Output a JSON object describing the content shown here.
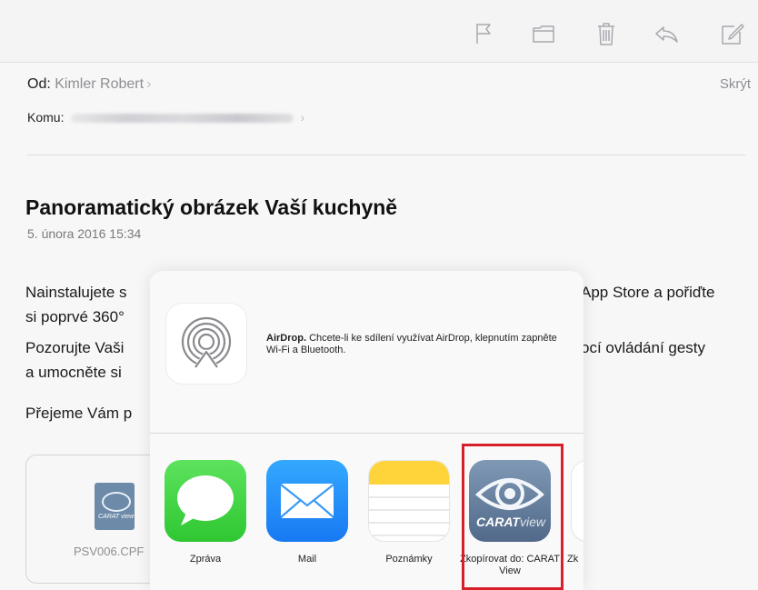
{
  "toolbar": {
    "icons": [
      "flag-icon",
      "folder-icon",
      "trash-icon",
      "reply-icon",
      "compose-icon"
    ]
  },
  "header": {
    "from_label": "Od:",
    "from_name": "Kimler Robert",
    "to_label": "Komu:",
    "hide_link": "Skrýt",
    "chevron": "›"
  },
  "message": {
    "subject": "Panoramatický obrázek Vaší kuchyně",
    "date": "5. února 2016 15:34",
    "para1_left_line1": "Nainstalujete s",
    "para1_left_line2": "si poprvé 360°",
    "para1_right_line1": "App Store a pořiďte",
    "para2_left_line1": "Pozorujte Vaši",
    "para2_left_line2": "a umocněte si",
    "para2_right_line1": "ocí ovládání gesty",
    "para3_left": "Přejeme Vám p",
    "attachment_name": "PSV006.CPF",
    "attachment_icon_text": "CARAT view"
  },
  "share_sheet": {
    "airdrop_title": "AirDrop.",
    "airdrop_text": "Chcete-li ke sdílení využívat AirDrop, klepnutím zapněte Wi-Fi a Bluetooth.",
    "apps": [
      {
        "label": "Zpráva",
        "icon": "messages-icon"
      },
      {
        "label": "Mail",
        "icon": "mail-icon"
      },
      {
        "label": "Poznámky",
        "icon": "notes-icon"
      },
      {
        "label": "Zkopírovat do: CARAT View",
        "icon": "carat-view-icon"
      },
      {
        "label": "Zk",
        "icon": "next-app-icon"
      }
    ],
    "carat_icon_text_bold": "CARAT",
    "carat_icon_text_light": "view"
  },
  "colors": {
    "highlight": "#d8202a",
    "messages_green": "#2fc731",
    "mail_blue": "#1879f3",
    "notes_yellow": "#ffd43b",
    "carat_blue": "#52698a"
  }
}
